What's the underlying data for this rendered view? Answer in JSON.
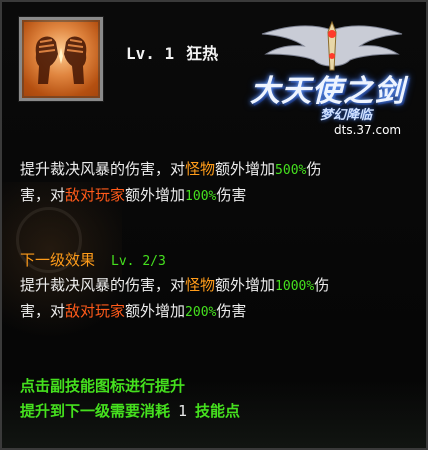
{
  "skill": {
    "level_label": "Lv. 1",
    "name": "狂热",
    "icon": "raised-fist-icon"
  },
  "logo": {
    "title": "大天使之剑",
    "subtitle": "梦幻降临",
    "url": "dts.37.com"
  },
  "current_effect": {
    "line1": {
      "pre": "提升裁决风暴的伤害，对",
      "monster": "怪物",
      "mid": "额外增加",
      "monster_value": "500%",
      "post": "伤"
    },
    "line2": {
      "pre": "害，对",
      "player": "敌对玩家",
      "mid": "额外增加",
      "player_value": "100%",
      "post": "伤害"
    }
  },
  "next_effect": {
    "title": "下一级效果",
    "level": "Lv. 2/3",
    "line1": {
      "pre": "提升裁决风暴的伤害，对",
      "monster": "怪物",
      "mid": "额外增加",
      "monster_value": "1000%",
      "post": "伤"
    },
    "line2": {
      "pre": "害，对",
      "player": "敌对玩家",
      "mid": "额外增加",
      "player_value": "200%",
      "post": "伤害"
    }
  },
  "upgrade": {
    "hint": "点击副技能图标进行提升",
    "cost_pre": "提升到下一级需要消耗",
    "cost_value": "1",
    "cost_unit": "技能点"
  },
  "colors": {
    "highlight_orange": "#ff9c1a",
    "highlight_red": "#ff5a1a",
    "value_green": "#45e01e",
    "text_white": "#ededed",
    "frame_border": "#3a3a3a"
  }
}
